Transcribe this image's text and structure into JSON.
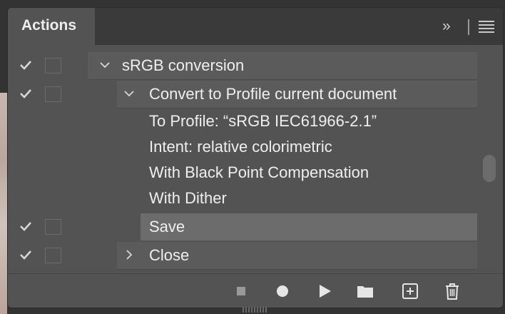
{
  "panel": {
    "tab_title": "Actions",
    "collapse_glyph": "»",
    "menu_icon": "hamburger-menu-icon"
  },
  "rows": [
    {
      "label": "sRGB conversion",
      "checked": true,
      "dialog": true,
      "expanded": true
    },
    {
      "label": "Convert to Profile current document",
      "checked": true,
      "dialog": true,
      "expanded": true
    },
    {
      "label": "To Profile:  “sRGB IEC61966-2.1”"
    },
    {
      "label": "Intent: relative colorimetric"
    },
    {
      "label": "With Black Point Compensation"
    },
    {
      "label": "With Dither"
    },
    {
      "label": "Save",
      "checked": true,
      "dialog": true,
      "selected": true
    },
    {
      "label": "Close",
      "checked": true,
      "dialog": true,
      "expanded": false
    }
  ],
  "toolbar": [
    "stop-icon",
    "record-icon",
    "play-icon",
    "folder-icon",
    "new-action-icon",
    "trash-icon"
  ],
  "colors": {
    "panel": "#535353",
    "tabbar": "#3a3a3a",
    "selected": "#6c6c6c",
    "row_band": "#5b5b5b"
  }
}
